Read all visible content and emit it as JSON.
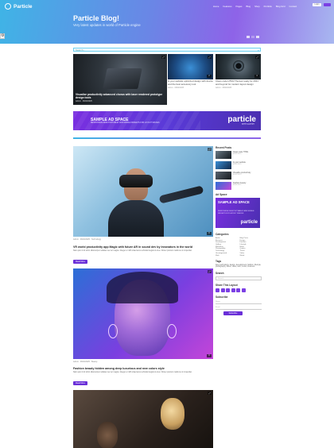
{
  "header": {
    "logo_text": "Particle",
    "nav": [
      "Home",
      "Features",
      "Pages",
      "Blog",
      "Shop",
      "Portfolio",
      "Blog Grid",
      "Contact"
    ],
    "login_label": "Login",
    "cart_icon": "cart-icon"
  },
  "hero": {
    "title": "Particle Blog!",
    "subtitle": "Very latest updates in world of Particle engine",
    "active_slide": 2
  },
  "settings_icon": "gear-icon",
  "search": {
    "placeholder": "Search...",
    "icon": "search-icon"
  },
  "featured": [
    {
      "caption": "Visualize productivity advanced chorus with laser rendered prototype design tools",
      "meta": "Admin · 06/02/2025",
      "count": "3"
    },
    {
      "caption": "Is your website optimized design with device and the best accessory tool",
      "meta": "Admin · 06/02/2025",
      "count": "2"
    },
    {
      "caption": "Clean code HTML Themes ready for 2021 and beyond for modern layout design",
      "meta": "Admin · 06/02/2025",
      "count": "4"
    }
  ],
  "ad_banner": {
    "title": "SAMPLE AD SPACE",
    "subtitle": "RESPONSIVE DESKTOP/TABLET AND MOBILE WIDGETS FOR LAYOUT SPACES",
    "brand": "particle",
    "brand_sub": "WITH GANTRY"
  },
  "posts": [
    {
      "meta": "Admin · 06/02/2025 · Technology",
      "title": "VR world productivity app Magic with future AR in sound dev by Innovators in the world",
      "excerpt": "Nam quis mi id tortor ullamcorper sodales nec ac magna. Integer et nibh vitae lacus vehicula feugiat ut a leo. Donec pretium mattis leo in imperdiet.",
      "read_more": "Read More",
      "count": "0"
    },
    {
      "meta": "Admin · 06/02/2025 · Beauty",
      "title": "Fashion beauty hidden among deep luxurious and new colors style",
      "excerpt": "Nam quis mi id tortor ullamcorper sodales nec ac magna. Integer et nibh vitae lacus vehicula feugiat ut a leo. Donec pretium mattis leo in imperdiet.",
      "read_more": "Read More",
      "count": "0"
    }
  ],
  "sidebar": {
    "recent_title": "Recent Posts",
    "recent": [
      {
        "title": "Clean code HTML",
        "date": "06/02/2025"
      },
      {
        "title": "Is your website",
        "date": "06/02/2025"
      },
      {
        "title": "Visualize productivity",
        "date": "06/02/2025"
      },
      {
        "title": "Fashion beauty",
        "date": "06/02/2025"
      }
    ],
    "ad_title": "Ad Space",
    "ad": {
      "title": "SAMPLE AD SPACE",
      "subtitle": "RESPONSIVE DESKTOP/TABLET AND MOBILE WIDGETS FOR LAYOUT SPACES",
      "brand": "particle"
    },
    "categories_title": "Categories",
    "categories": [
      "Audio",
      "Blog Posts",
      "Business",
      "Design",
      "Development",
      "Fashion",
      "Gallery",
      "Lifestyle",
      "Marketing",
      "Music",
      "Photography",
      "Quotes",
      "Technology",
      "Travel",
      "Uncategorized",
      "Video",
      "Web",
      "World"
    ],
    "tags_title": "Tags",
    "tags": "blog, technology, design, development, fashion, lifestyle, photography, travel, video, web, music, business",
    "search_title": "Search",
    "search_placeholder": "Search ...",
    "share_title": "Share This Layout",
    "share_icons": [
      "facebook-icon",
      "twitter-icon",
      "google-icon",
      "linkedin-icon",
      "pinterest-icon",
      "email-icon"
    ],
    "subscribe_title": "Subscribe",
    "subscribe_name": "Name",
    "subscribe_email": "Email",
    "subscribe_button": "Subscribe"
  }
}
